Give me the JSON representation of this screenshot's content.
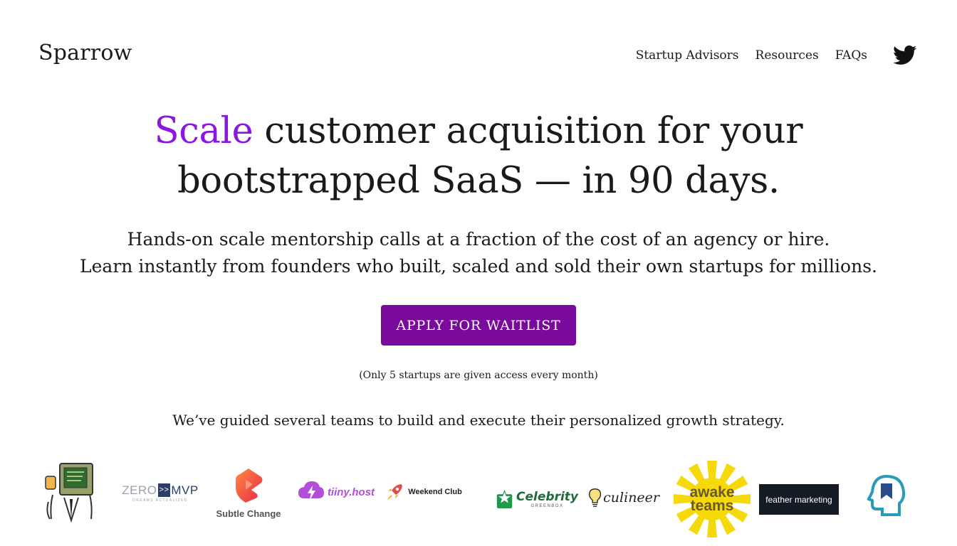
{
  "header": {
    "logo": "Sparrow",
    "nav": [
      "Startup Advisors",
      "Resources",
      "FAQs"
    ],
    "social_icon": "twitter-icon"
  },
  "hero": {
    "headline_accent": "Scale",
    "headline_line1_rest": " customer acquisition for your",
    "headline_line2": "bootstrapped SaaS — in 90 days.",
    "sub_line1": "Hands-on scale mentorship calls at a fraction of the cost of an agency or hire.",
    "sub_line2": "Learn instantly from founders who built, scaled and sold their own startups for millions."
  },
  "cta": {
    "label": "APPLY FOR WAITLIST",
    "note": "(Only 5 startups are given access every month)"
  },
  "social_proof": {
    "text": "We’ve guided several teams to build and execute their personalized growth strategy."
  },
  "logos": {
    "zero": "ZERO",
    "mvp_arrow": ">>",
    "mvp": "MVP",
    "zero_tagline": "DREAMS ACTUALIZED",
    "subtle_change": "Subtle Change",
    "tiiny": "tiiny.host",
    "weekend": "Weekend Club",
    "celebrity": "Celebrity",
    "celebrity_sub": "GREENBOX",
    "culineer": "culineer",
    "awake_line1": "awake",
    "awake_line2": "teams",
    "feather": "feather marketing"
  },
  "colors": {
    "accent": "#8a16e0",
    "button": "#7a0a9c",
    "text": "#1a1a1a"
  }
}
